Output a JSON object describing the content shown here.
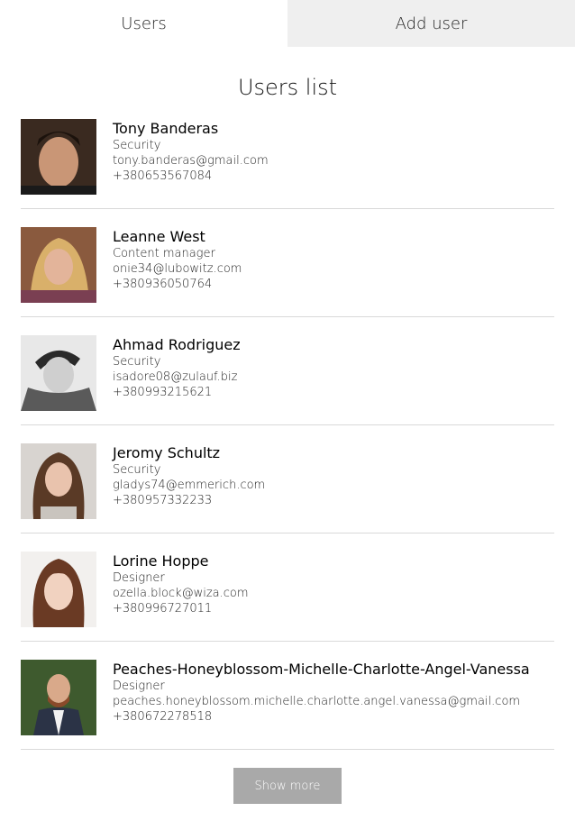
{
  "tabs": [
    {
      "label": "Users",
      "active": true
    },
    {
      "label": "Add user",
      "active": false
    }
  ],
  "page_title": "Users list",
  "users": [
    {
      "name": "Tony Banderas",
      "position": "Security",
      "email": "tony.banderas@gmail.com",
      "phone": "+380653567084"
    },
    {
      "name": "Leanne West",
      "position": "Content manager",
      "email": "onie34@lubowitz.com",
      "phone": "+380936050764"
    },
    {
      "name": "Ahmad Rodriguez",
      "position": "Security",
      "email": "isadore08@zulauf.biz",
      "phone": "+380993215621"
    },
    {
      "name": "Jeromy Schultz",
      "position": "Security",
      "email": "gladys74@emmerich.com",
      "phone": "+380957332233"
    },
    {
      "name": "Lorine Hoppe",
      "position": "Designer",
      "email": "ozella.block@wiza.com",
      "phone": "+380996727011"
    },
    {
      "name": "Peaches-Honeyblossom-Michelle-Charlotte-Angel-Vanessa",
      "position": "Designer",
      "email": "peaches.honeyblossom.michelle.charlotte.angel.vanessa@gmail.com",
      "phone": "+380672278518"
    }
  ],
  "show_more_label": "Show more",
  "colors": {
    "tab_inactive_bg": "#efefef",
    "button_bg": "#a9a9a9",
    "divider": "#d9d9d9"
  }
}
